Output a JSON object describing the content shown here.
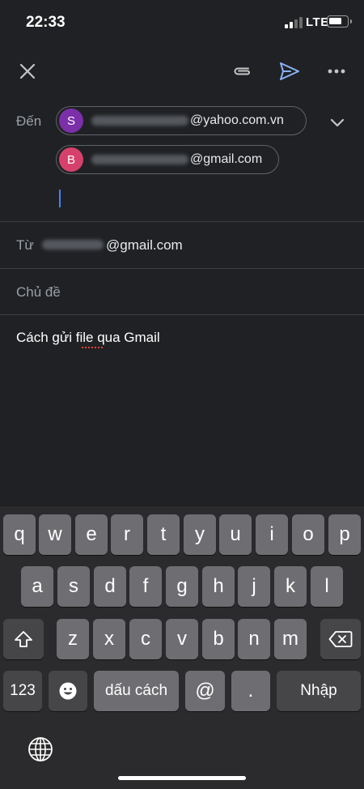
{
  "status_bar": {
    "time": "22:33",
    "network": "LTE"
  },
  "compose": {
    "to_label": "Đến",
    "recipients": [
      {
        "initial": "S",
        "domain": "@yahoo.com.vn",
        "color": "#7b2fa8"
      },
      {
        "initial": "B",
        "domain": "@gmail.com",
        "color": "#d6416b"
      }
    ],
    "from_label": "Từ",
    "from_domain": "@gmail.com",
    "subject_placeholder": "Chủ đề",
    "body": "Cách gửi file qua Gmail"
  },
  "icons": {
    "close": "close-icon",
    "attach": "paperclip-icon",
    "send": "send-icon",
    "more": "more-horizontal-icon",
    "expand": "chevron-down-icon",
    "shift": "shift-icon",
    "backspace": "backspace-icon",
    "emoji": "emoji-icon",
    "globe": "globe-icon"
  },
  "colors": {
    "accent": "#8ab4f8",
    "cursor": "#4285f4",
    "background": "#202124"
  },
  "keyboard": {
    "row1": [
      "q",
      "w",
      "e",
      "r",
      "t",
      "y",
      "u",
      "i",
      "o",
      "p"
    ],
    "row2": [
      "a",
      "s",
      "d",
      "f",
      "g",
      "h",
      "j",
      "k",
      "l"
    ],
    "row3": [
      "z",
      "x",
      "c",
      "v",
      "b",
      "n",
      "m"
    ],
    "numbers_key": "123",
    "space_key": "dấu cách",
    "at_key": "@",
    "dot_key": ".",
    "return_key": "Nhập"
  }
}
